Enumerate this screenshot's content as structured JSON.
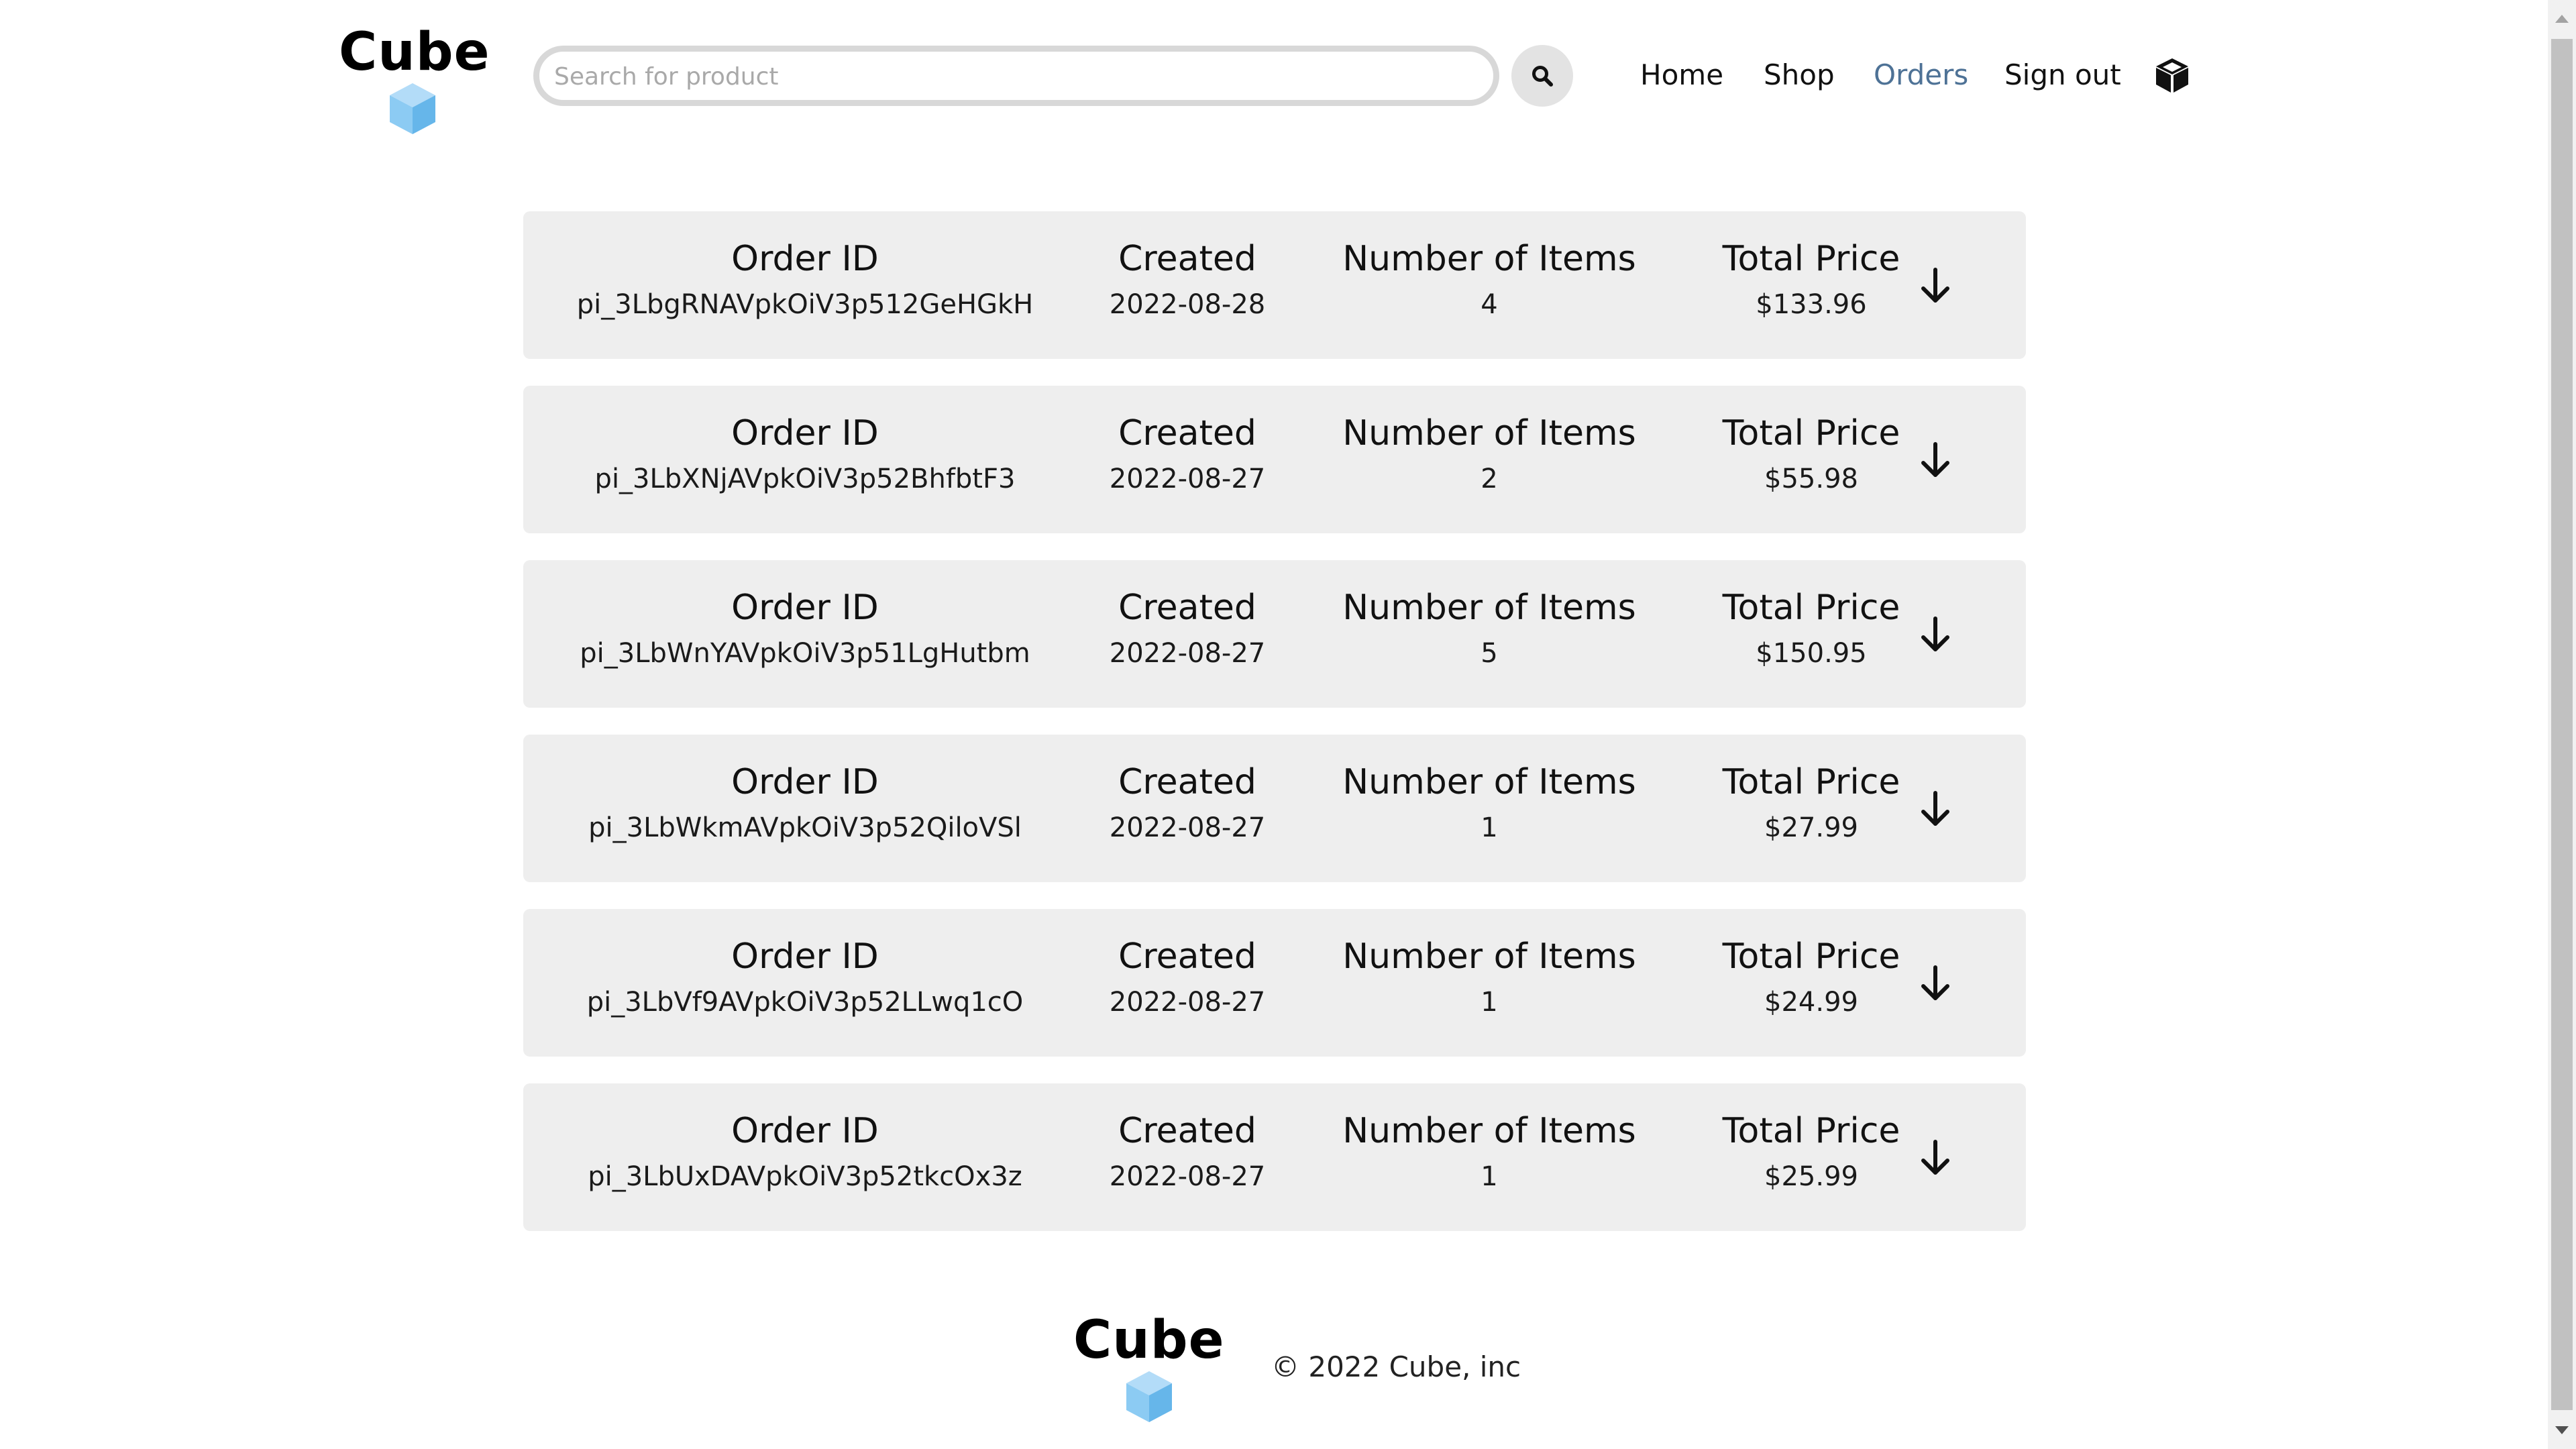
{
  "header": {
    "logo_text": "Cube",
    "search": {
      "placeholder": "Search for product",
      "value": ""
    },
    "search_icon": "magnifier-icon",
    "nav": [
      {
        "label": "Home",
        "active": false
      },
      {
        "label": "Shop",
        "active": false
      },
      {
        "label": "Orders",
        "active": true
      },
      {
        "label": "Sign out",
        "active": false
      }
    ],
    "cube_icon": "cube-icon"
  },
  "order_columns": {
    "id": "Order ID",
    "created": "Created",
    "items": "Number of Items",
    "total": "Total Price"
  },
  "orders": [
    {
      "id": "pi_3LbgRNAVpkOiV3p512GeHGkH",
      "created": "2022-08-28",
      "items": "4",
      "total": "$133.96"
    },
    {
      "id": "pi_3LbXNjAVpkOiV3p52BhfbtF3",
      "created": "2022-08-27",
      "items": "2",
      "total": "$55.98"
    },
    {
      "id": "pi_3LbWnYAVpkOiV3p51LgHutbm",
      "created": "2022-08-27",
      "items": "5",
      "total": "$150.95"
    },
    {
      "id": "pi_3LbWkmAVpkOiV3p52QiloVSl",
      "created": "2022-08-27",
      "items": "1",
      "total": "$27.99"
    },
    {
      "id": "pi_3LbVf9AVpkOiV3p52LLwq1cO",
      "created": "2022-08-27",
      "items": "1",
      "total": "$24.99"
    },
    {
      "id": "pi_3LbUxDAVpkOiV3p52tkcOx3z",
      "created": "2022-08-27",
      "items": "1",
      "total": "$25.99"
    }
  ],
  "footer": {
    "logo_text": "Cube",
    "copyright": "© 2022 Cube, inc"
  },
  "colors": {
    "accent_link": "#4e7296",
    "card_bg": "#eeeeee",
    "cube_light": "#a9d7f7",
    "cube_mid": "#7cc3f1",
    "cube_dark": "#5aaee6"
  }
}
